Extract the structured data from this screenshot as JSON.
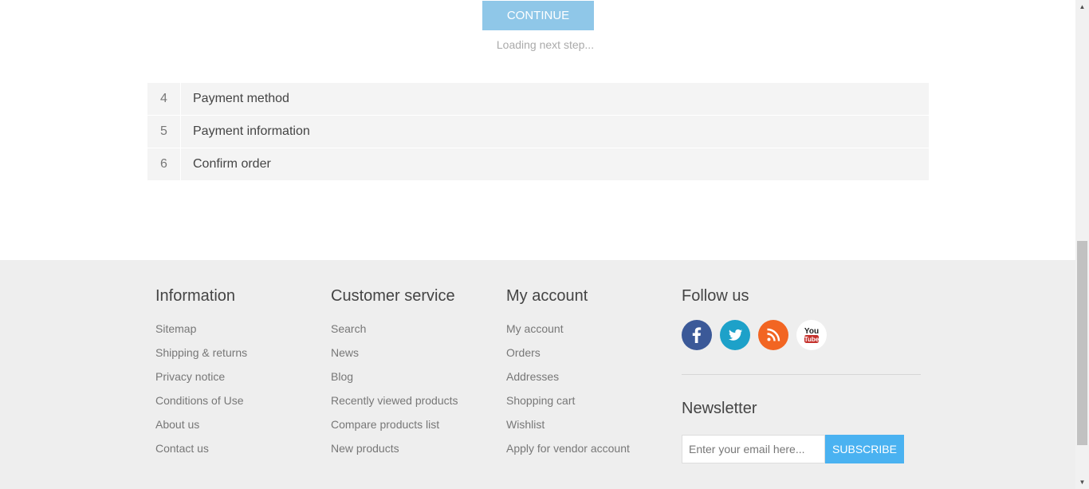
{
  "checkout": {
    "continue_label": "CONTINUE",
    "loading_text": "Loading next step...",
    "steps": [
      {
        "number": "4",
        "title": "Payment method"
      },
      {
        "number": "5",
        "title": "Payment information"
      },
      {
        "number": "6",
        "title": "Confirm order"
      }
    ]
  },
  "footer": {
    "information": {
      "title": "Information",
      "links": [
        "Sitemap",
        "Shipping & returns",
        "Privacy notice",
        "Conditions of Use",
        "About us",
        "Contact us"
      ]
    },
    "customer_service": {
      "title": "Customer service",
      "links": [
        "Search",
        "News",
        "Blog",
        "Recently viewed products",
        "Compare products list",
        "New products"
      ]
    },
    "my_account": {
      "title": "My account",
      "links": [
        "My account",
        "Orders",
        "Addresses",
        "Shopping cart",
        "Wishlist",
        "Apply for vendor account"
      ]
    },
    "follow_us": {
      "title": "Follow us",
      "icons": [
        "facebook-icon",
        "twitter-icon",
        "rss-icon",
        "youtube-icon"
      ],
      "youtube_text_top": "You",
      "youtube_text_bottom": "Tube"
    },
    "newsletter": {
      "title": "Newsletter",
      "placeholder": "Enter your email here...",
      "subscribe_label": "SUBSCRIBE"
    }
  },
  "colors": {
    "continue_button": "#8fc7e8",
    "subscribe_button": "#4ab2f1",
    "facebook": "#3b5998",
    "twitter": "#1da1c9",
    "rss": "#f26522",
    "footer_bg": "#eeeeee"
  }
}
